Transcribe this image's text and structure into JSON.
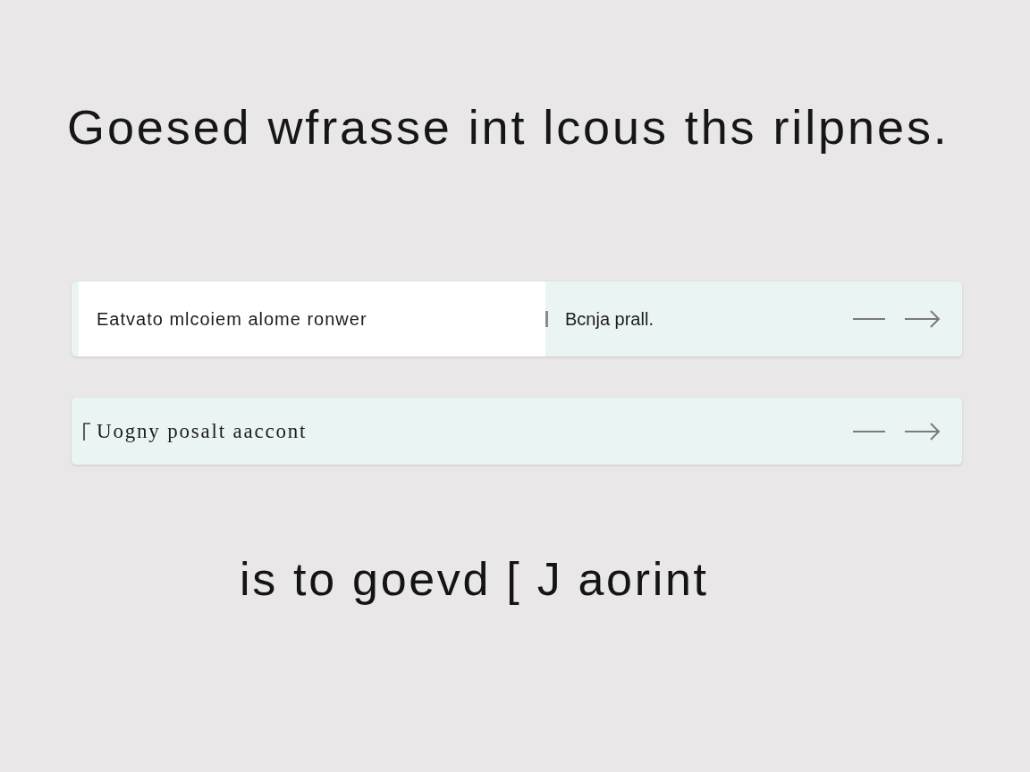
{
  "heading": "Goesed wfrasse int lcous ths rilpnes.",
  "input_row": {
    "field": {
      "value": "Eatvato mlcoiem alome ronwer"
    },
    "button": {
      "label": "Bcnja prall."
    }
  },
  "action_row": {
    "label": "Uogny posalt aaccont"
  },
  "footer_text": "is to goevd [ J aorint"
}
